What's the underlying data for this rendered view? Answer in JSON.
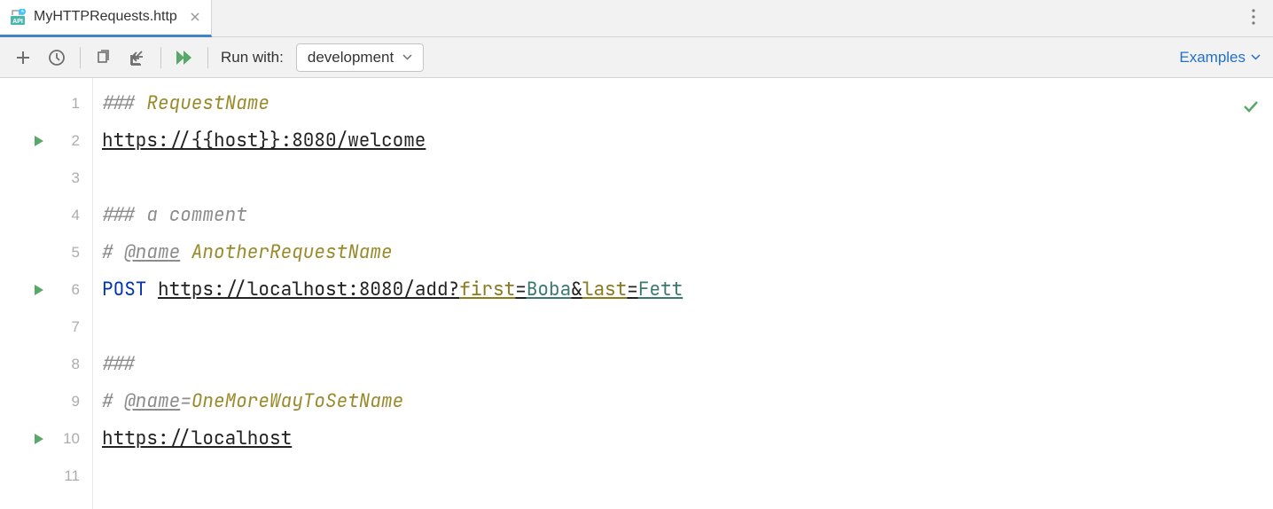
{
  "tab": {
    "filename": "MyHTTPRequests.http"
  },
  "toolbar": {
    "run_with_label": "Run with:",
    "environment": "development",
    "examples_label": "Examples"
  },
  "gutter": {
    "lines": [
      "1",
      "2",
      "3",
      "4",
      "5",
      "6",
      "7",
      "8",
      "9",
      "10",
      "11"
    ],
    "run_markers": [
      2,
      6,
      10
    ]
  },
  "code": {
    "l1": {
      "hash": "### ",
      "name": "RequestName"
    },
    "l2": {
      "url": "https://{{host}}:8080/welcome"
    },
    "l4": {
      "hash": "### ",
      "text": "a comment"
    },
    "l5": {
      "hash": "# ",
      "at": "@name",
      "sep": " ",
      "val": "AnotherRequestName"
    },
    "l6": {
      "method": "POST",
      "url": "https://localhost:8080/add?",
      "p1": "first",
      "v1": "Boba",
      "p2": "last",
      "v2": "Fett",
      "eq": "=",
      "amp": "&"
    },
    "l8": {
      "hash": "###"
    },
    "l9": {
      "hash": "# ",
      "at": "@name",
      "sep": "=",
      "val": "OneMoreWayToSetName"
    },
    "l10": {
      "url": "https://localhost"
    }
  }
}
